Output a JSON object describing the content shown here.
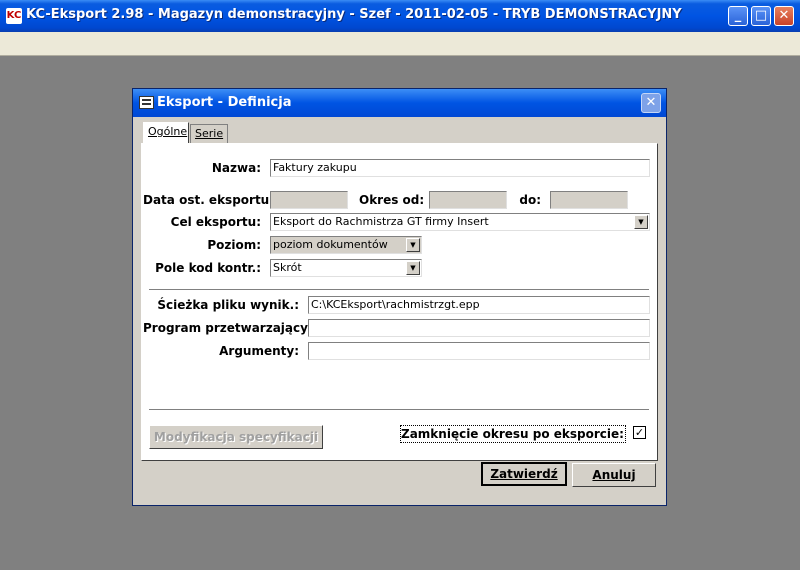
{
  "window": {
    "title": "KC-Eksport 2.98 - Magazyn demonstracyjny - Szef - 2011-02-05 - TRYB DEMONSTRACYJNY",
    "app_icon_text": "KC",
    "minimize_glyph": "_",
    "maximize_glyph": "□",
    "close_glyph": "✕"
  },
  "dialog": {
    "title": "Eksport - Definicja",
    "close_glyph": "✕",
    "tabs": [
      {
        "label": "Ogólne",
        "active": true
      },
      {
        "label": "Serie",
        "active": false
      }
    ],
    "form": {
      "nazwa_label": "Nazwa:",
      "nazwa_value": "Faktury zakupu",
      "data_ost_label": "Data ost. eksportu:",
      "data_ost_value": "",
      "okres_od_label": "Okres od:",
      "okres_od_value": "",
      "do_label": "do:",
      "do_value": "",
      "cel_label": "Cel eksportu:",
      "cel_value": "Eksport do Rachmistrza GT firmy Insert",
      "poziom_label": "Poziom:",
      "poziom_value": "poziom dokumentów",
      "pole_kod_label": "Pole kod kontr.:",
      "pole_kod_value": "Skrót",
      "sciezka_label": "Ścieżka pliku wynik.:",
      "sciezka_value": "C:\\KCEksport\\rachmistrzgt.epp",
      "program_label": "Program przetwarzający:",
      "program_value": "",
      "argumenty_label": "Argumenty:",
      "argumenty_value": "",
      "modyfikacja_label": "Modyfikacja specyfikacji",
      "zamkniecie_label": "Zamknięcie okresu po eksporcie:",
      "zamkniecie_checked": true,
      "check_glyph": "✓"
    },
    "buttons": {
      "ok_label": "Zatwierdź",
      "cancel_label": "Anuluj"
    }
  },
  "icons": [
    "app-icon",
    "minimize-icon",
    "maximize-icon",
    "close-icon",
    "dialog-icon",
    "chevron-down-icon",
    "checkmark-icon"
  ]
}
